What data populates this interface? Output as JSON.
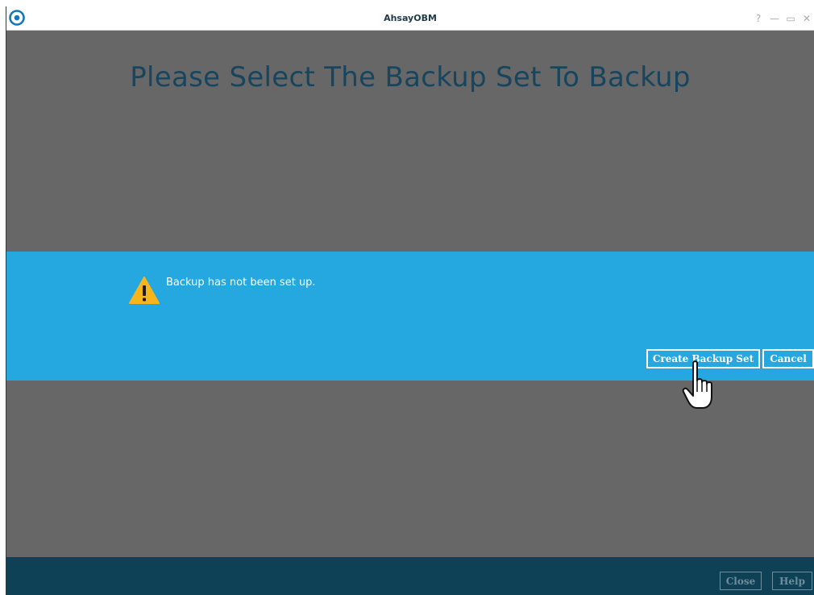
{
  "window": {
    "title": "AhsayOBM",
    "controls": {
      "help": "?",
      "minimize": "—",
      "maximize": "▭",
      "close": "✕"
    }
  },
  "main": {
    "heading": "Please Select The Backup Set To Backup"
  },
  "dialog": {
    "icon": "warning-icon",
    "message": "Backup has not been set up.",
    "create_button": "Create Backup Set",
    "cancel_button": "Cancel"
  },
  "footer": {
    "close_button": "Close",
    "help_button": "Help"
  },
  "colors": {
    "overlay": "#676767",
    "dialog": "#25a7df",
    "heading": "#18455e",
    "footer": "#0f4156",
    "warning": "#f5b51b"
  }
}
